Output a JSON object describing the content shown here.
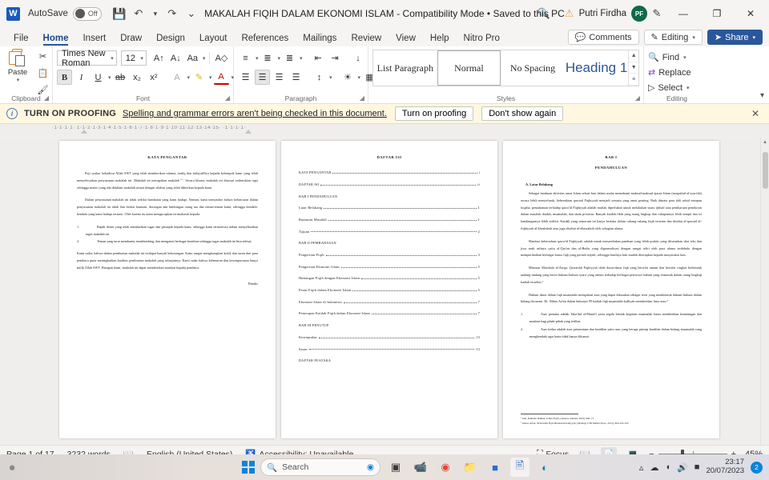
{
  "titlebar": {
    "app_logo": "word-logo",
    "autosave_label": "AutoSave",
    "autosave_state": "Off",
    "document_title": "MAKALAH FIQIH DALAM EKONOMI ISLAM  -  Compatibility Mode • Saved to this PC",
    "user_name": "Putri Firdha",
    "avatar_initials": "PF",
    "minimize": "—",
    "maximize": "❐",
    "close": "✕"
  },
  "ribbon_tabs": {
    "items": [
      {
        "label": "File",
        "active": false
      },
      {
        "label": "Home",
        "active": true
      },
      {
        "label": "Insert",
        "active": false
      },
      {
        "label": "Draw",
        "active": false
      },
      {
        "label": "Design",
        "active": false
      },
      {
        "label": "Layout",
        "active": false
      },
      {
        "label": "References",
        "active": false
      },
      {
        "label": "Mailings",
        "active": false
      },
      {
        "label": "Review",
        "active": false
      },
      {
        "label": "View",
        "active": false
      },
      {
        "label": "Help",
        "active": false
      },
      {
        "label": "Nitro Pro",
        "active": false
      }
    ],
    "comments_label": "Comments",
    "editing_label": "Editing",
    "share_label": "Share"
  },
  "ribbon": {
    "clipboard": {
      "group_label": "Clipboard",
      "paste_label": "Paste"
    },
    "font": {
      "group_label": "Font",
      "font_name": "Times New Roman",
      "font_size": "12"
    },
    "paragraph": {
      "group_label": "Paragraph"
    },
    "styles": {
      "group_label": "Styles",
      "items": [
        {
          "label": "List Paragraph",
          "selected": false
        },
        {
          "label": "Normal",
          "selected": true
        },
        {
          "label": "No Spacing",
          "selected": false
        },
        {
          "label": "Heading 1",
          "selected": false
        }
      ]
    },
    "editing": {
      "group_label": "Editing",
      "find_label": "Find",
      "replace_label": "Replace",
      "select_label": "Select"
    }
  },
  "proofing_bar": {
    "title": "TURN ON PROOFING",
    "message": "Spelling and grammar errors aren't being checked in this document.",
    "primary_button": "Turn on proofing",
    "secondary_button": "Don't show again",
    "close": "✕"
  },
  "ruler": {
    "marks": "·1·1·1·1· 1·1·2·1·3·1·4·1·5·1·6·1·7·1·8·1·9·1·10·11·12·13·14·15· ·1·1·1·1·"
  },
  "document": {
    "pages": [
      {
        "title": "KATA PENGANTAR",
        "paragraphs": [
          "Puji syukur kehadirat Allah SWT yang telah memberikan rahmat, taufiq dan hidayahNya kepada kelompok kami yang telah menyelesaikan penyusunan makalah ini. Makalah ini merupakan makalah \"\". Secara khusus makalah ini disusun sedemikian rupa sehingga materi yang ada didalam makalah sesuai dengan silabus yang telah diberikan kepada kami.",
          "Dalam penyusunan makalah ini tidak sedikit hambatan yang kami hadapi. Namun, kami menyadari bahwa kelancaran dalam penyusunan makalah ini tidak lain berkat bantuan, dorongan dan bimbingan orang tua dan teman-teman kami, sehingga kendala-kendala yang kami hadapi teratasi. Oleh karena itu kami mengucapkan terimakasih kepada:"
        ],
        "list": [
          {
            "num": "1.",
            "text": "Bapak dosen yang telah memberikan tugas dan petunjuk kepada kami, sehingga kami termotivasi dalam menyelesaikan tugas makalah ini."
          },
          {
            "num": "2.",
            "text": "Teman yang turut membantu, membimbing, dan mengatasi berbagai kesulitan sehingga tugas makalah ini bisa selesai."
          }
        ],
        "closing": "Kami sadar, bahwa dalam pembuatan makalah ini terdapat banyak kekurangan. Kami sangat mengharapkan kritik dan saran dari para pembaca guna meningkatkan kualitas pembuatan makalah yang selanjutnya. Kami sadar bahwa kebenaran dan kesempurnaan hanya milik Allah SWT. Harapan kami, makalah ini dapat memberikan manfaat kepada pembaca.",
        "signature": "Penulis"
      },
      {
        "title": "DAFTAR ISI",
        "entries": [
          {
            "label": "KATA PENGANTAR",
            "page": "i",
            "is_heading": false
          },
          {
            "label": "DAFTAR ISI",
            "page": "ii",
            "is_heading": false
          },
          {
            "label": "BAB I PENDAHULUAN",
            "page": "",
            "is_heading": true
          },
          {
            "label": "Latar Belakang",
            "page": "1",
            "is_heading": false
          },
          {
            "label": "Rumusan Masalah",
            "page": "1",
            "is_heading": false
          },
          {
            "label": "Tujuan",
            "page": "2",
            "is_heading": false
          },
          {
            "label": "BAB II PEMBAHASAN",
            "page": "",
            "is_heading": true
          },
          {
            "label": "Pengertian Fiqih",
            "page": "3",
            "is_heading": false
          },
          {
            "label": "Pengertian Ekonomi Islam",
            "page": "5",
            "is_heading": false
          },
          {
            "label": "Hubungan Fiqih dengan Ekonomi Islam",
            "page": "5",
            "is_heading": false
          },
          {
            "label": "Peran Fiqih dalam Ekonomi Islam",
            "page": "5",
            "is_heading": false
          },
          {
            "label": "Ekonomi Islam di Indonesia",
            "page": "7",
            "is_heading": false
          },
          {
            "label": "Penerapan Kaidah Fiqih dalam Ekonomi Islam",
            "page": "7",
            "is_heading": false
          },
          {
            "label": "BAB III PENUTUP",
            "page": "",
            "is_heading": true
          },
          {
            "label": "Kesimpulan",
            "page": "13",
            "is_heading": false
          },
          {
            "label": "Saran",
            "page": "13",
            "is_heading": false
          },
          {
            "label": "DAFTAR PUSTAKA",
            "page": "",
            "is_heading": true
          }
        ]
      },
      {
        "title": "BAB I",
        "subtitle": "PENDAHULUAN",
        "section": "A.  Latar Belakang",
        "paragraphs": [
          "Sebagai landasan aktivitas umat Islam sehari-hari dalam usaha memahami maksud-maksud ajaran Islam (maqashid al-syari'ah) secara lebih menyeluruh, keberadaan qawaid Fiqhiyyah menjadi sesuatu yang amat penting. Baik dimata para ahli ushul maupun fuqaha, pemahaman terhadap qawa'id Fiqhiyyah adalah mutlak diperlukan untuk melakukan suatu ijtihad atau pembaruan pemikiran dalam masalah ibadah, muamalah, dan skala prioritas. Banyak kaidah fikih yang ruang lingkup dan cakupannya lebih sempit dan isi kandungannya lebih sedikit. Kaidah yang semacam ini hanya berlaku dalam cabang-cabang fiqih tertentu dan disebut al-qawaid al-fiqhiyyah al-khashshah atau juga disebut al-dhawabith oleh sebagian ulama.",
          "Manfaat keberadaan qawa'id Fiqhiyyah adalah untuk menyediakan panduan yang lebih praktis yang diturunkan dari teks dan jiwa nash aslinya yaitu al-Qur'an dan al-Hadis yang digeneralisasi dengan sangat teliti oleh para ulama terdahulu dengan memperhatikan berbagai kasus fiqh yang pernah terjadi, sehingga hasilnya kini mudah diterapkan kepada masyarakat luas.",
          "Menurut Musthafa al-Zarqa, Qawaidul Fiqhiyyah ialah dasar-dasar fiqh yang bersifat umum dan bersifat ringkas berbentuk undang-undang yang berisi hukum-hukum syara' yang umum terhadap berbagai peristiwa hukum yang termasuk dalam ruang lingkup kaidah tersebut.¹",
          "Hukum dasar dalam fiqh muamalah merupakan asas yang dapat dikatakan sebagai teori yang membentuk hukum-hukum dalam bidang ekonomi. Dr. Abbas Arfan dalam bukunya 99 kaidah fiqh muamalah kulliyah memberikan lima asas:²"
        ],
        "list": [
          {
            "num": "1.",
            "text": "Asas pertama adalah Taba'dul al-Mana'fi yaitu segala bentuk kegiatan muamalah harus memberikan keuntungan dan manfaat bagi pihak-pihak yang terlibat."
          },
          {
            "num": "2.",
            "text": "Asas kedua adalah asas pemerataan dan keadilan yaitu asas yang berupa prinsip keadilan dalam bidang muamalah yang menghendaki agar harta tidak hanya dikuasai"
          }
        ],
        "footnotes": [
          "¹ Abd. Rahman Dahlan, Ushul Fiqih, (Jakarta: Amzah, 2010) hlm. 13",
          "² Abbas Arfan, 99 Kaidah Fiqh Muamalah Kuliyyah, (Malang: UIN Maliki Press, 2013), hlm.103-105."
        ],
        "footnote_link_text": "Malang"
      }
    ]
  },
  "statusbar": {
    "page_indicator": "Page 1 of 17",
    "word_count": "3232 words",
    "proofing_icon": "proofing-error-icon",
    "language": "English (United States)",
    "accessibility": "Accessibility: Unavailable",
    "focus_label": "Focus",
    "views": [
      "read-mode-icon",
      "print-layout-icon",
      "web-layout-icon"
    ],
    "active_view": "print-layout-icon",
    "zoom_out": "−",
    "zoom_in": "+",
    "zoom_level": "45%"
  },
  "taskbar": {
    "search_placeholder": "Search",
    "apps": [
      {
        "name": "start-button"
      },
      {
        "name": "task-view-icon"
      },
      {
        "name": "teams-icon"
      },
      {
        "name": "chrome-icon"
      },
      {
        "name": "file-explorer-icon"
      },
      {
        "name": "nitro-icon"
      },
      {
        "name": "word-icon"
      },
      {
        "name": "edge-icon"
      }
    ],
    "time": "23:17",
    "date": "20/07/2023",
    "notification_count": "2"
  }
}
